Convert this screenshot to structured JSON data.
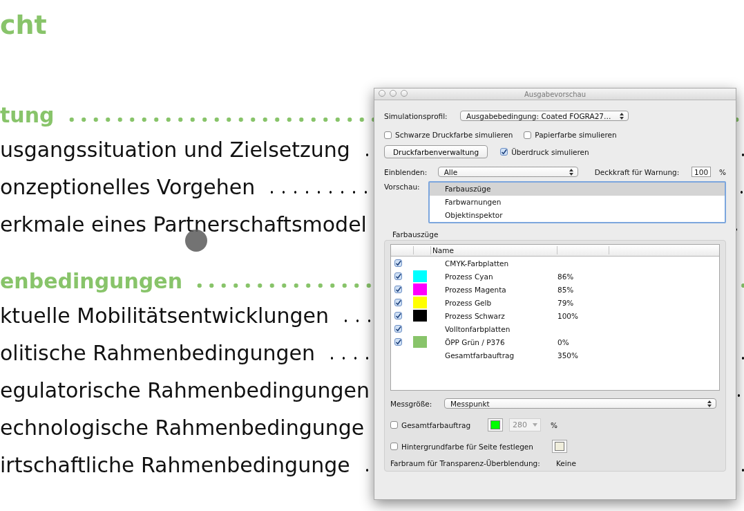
{
  "document": {
    "title": "cht",
    "sections": [
      {
        "heading": "tung",
        "entries": [
          "usgangssituation und Zielsetzung",
          "onzeptionelles Vorgehen",
          "erkmale eines Partnerschaftsmodel"
        ]
      },
      {
        "heading": "enbedingungen",
        "entries": [
          "ktuelle Mobilitätsentwicklungen",
          "olitische Rahmenbedingungen",
          "egulatorische Rahmenbedingungen",
          "echnologische Rahmenbedingunge",
          "irtschaftliche Rahmenbedingunge"
        ]
      }
    ]
  },
  "dialog": {
    "title": "Ausgabevorschau",
    "simulation_profile": {
      "label": "Simulationsprofil:",
      "value": "Ausgabebedingung: Coated FOGRA27…"
    },
    "simulate_options": [
      {
        "label": "Schwarze Druckfarbe simulieren",
        "checked": false
      },
      {
        "label": "Papierfarbe simulieren",
        "checked": false
      }
    ],
    "ink_manager_button": "Druckfarbenverwaltung",
    "overprint": {
      "label": "Überdruck simulieren",
      "checked": true
    },
    "show": {
      "label": "Einblenden:",
      "value": "Alle"
    },
    "warning_opacity": {
      "label": "Deckkraft für Warnung:",
      "value": "100",
      "unit": "%"
    },
    "preview": {
      "label": "Vorschau:",
      "items": [
        {
          "label": "Farbauszüge",
          "selected": true
        },
        {
          "label": "Farbwarnungen",
          "selected": false
        },
        {
          "label": "Objektinspektor",
          "selected": false
        }
      ]
    },
    "separations": {
      "title": "Farbauszüge",
      "column": "Name",
      "rows": [
        {
          "kind": "group",
          "checked": true,
          "name": "CMYK-Farbplatten"
        },
        {
          "kind": "ink",
          "checked": true,
          "color": "#00ffff",
          "name": "Prozess Cyan",
          "coverage": "86%"
        },
        {
          "kind": "ink",
          "checked": true,
          "color": "#ff00ff",
          "name": "Prozess Magenta",
          "coverage": "85%"
        },
        {
          "kind": "ink",
          "checked": true,
          "color": "#ffff00",
          "name": "Prozess Gelb",
          "coverage": "79%"
        },
        {
          "kind": "ink",
          "checked": true,
          "color": "#000000",
          "name": "Prozess Schwarz",
          "coverage": "100%"
        },
        {
          "kind": "group",
          "checked": true,
          "name": "Volltonfarbplatten"
        },
        {
          "kind": "ink",
          "checked": true,
          "color": "#88c46a",
          "name": "ÖPP Grün / P376",
          "coverage": "0%"
        },
        {
          "kind": "total",
          "name": "Gesamtfarbauftrag",
          "coverage": "350%"
        }
      ]
    },
    "measure": {
      "label": "Messgröße:",
      "value": "Messpunkt"
    },
    "total_ink": {
      "label": "Gesamtfarbauftrag",
      "checked": false,
      "color": "#00ff00",
      "value": "280",
      "disabled": true,
      "unit": "%"
    },
    "background_color": {
      "label": "Hintergrundfarbe für Seite festlegen",
      "checked": false,
      "color": "#f0eedc"
    },
    "blend_space": {
      "label": "Farbraum für Transparenz-Überblendung:",
      "value": "Keine"
    }
  }
}
